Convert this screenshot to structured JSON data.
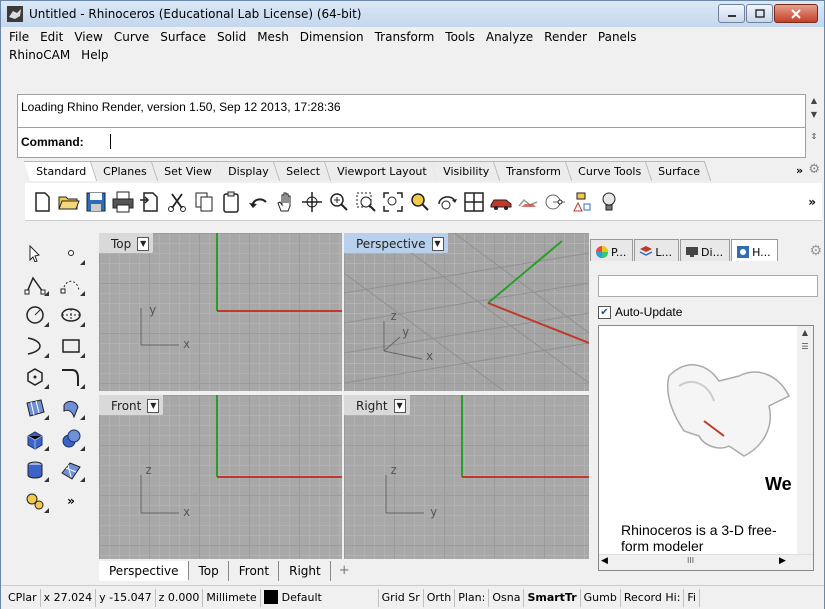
{
  "window": {
    "title": "Untitled - Rhinoceros (Educational Lab License) (64-bit)"
  },
  "menu": {
    "row1": [
      "File",
      "Edit",
      "View",
      "Curve",
      "Surface",
      "Solid",
      "Mesh",
      "Dimension",
      "Transform",
      "Tools",
      "Analyze",
      "Render",
      "Panels"
    ],
    "row2": [
      "RhinoCAM",
      "Help"
    ]
  },
  "command": {
    "history_line": "Loading Rhino Render, version 1.50, Sep 12 2013, 17:28:36",
    "prompt_label": "Command:",
    "value": ""
  },
  "toolbar_tabs": [
    "Standard",
    "CPlanes",
    "Set View",
    "Display",
    "Select",
    "Viewport Layout",
    "Visibility",
    "Transform",
    "Curve Tools",
    "Surface"
  ],
  "toolbar_more": "»",
  "toolbar_icons": [
    "new-file-icon",
    "open-folder-icon",
    "save-icon",
    "print-icon",
    "import-icon",
    "cut-icon",
    "copy-icon",
    "paste-icon",
    "undo-icon",
    "pan-hand-icon",
    "rotate-view-icon",
    "zoom-in-icon",
    "zoom-window-icon",
    "zoom-extents-icon",
    "zoom-selected-icon",
    "rotate-camera-icon",
    "four-viewports-icon",
    "car-render-icon",
    "render-preview-icon",
    "curve-point-icon",
    "named-cplane-icon",
    "light-bulb-icon"
  ],
  "left_toolbar_icons": [
    "select-arrow-icon",
    "point-icon",
    "polyline-icon",
    "control-point-curve-icon",
    "circle-icon",
    "ellipse-icon",
    "arc-icon",
    "rectangle-icon",
    "polygon-icon",
    "fillet-icon",
    "surface-from-points-icon",
    "extrude-surface-icon",
    "box-solid-icon",
    "boolean-icon",
    "cylinder-icon",
    "planar-surface-icon",
    "transform-gear-icon"
  ],
  "left_toolbar_more": "»",
  "viewports": [
    {
      "name": "Top",
      "axis_h": "x",
      "axis_v": "y"
    },
    {
      "name": "Perspective",
      "axis_h": "x",
      "axis_v": "z",
      "axis_d": "y"
    },
    {
      "name": "Front",
      "axis_h": "x",
      "axis_v": "z"
    },
    {
      "name": "Right",
      "axis_h": "y",
      "axis_v": "z"
    }
  ],
  "viewport_tabs": [
    "Perspective",
    "Top",
    "Front",
    "Right"
  ],
  "viewport_tab_add": "+",
  "panel": {
    "tabs": [
      "P...",
      "L...",
      "Di...",
      "H..."
    ],
    "auto_update_label": "Auto-Update",
    "auto_update_checked": true,
    "welcome": "We",
    "body_text": "Rhinoceros is a 3-D free-form modeler",
    "scroll_grip": "III"
  },
  "status": {
    "cplane": "CPlar",
    "x": "x 27.024",
    "y": "y -15.047",
    "z": "z 0.000",
    "units": "Millimete",
    "layer": "Default",
    "grid_snap": "Grid Sr",
    "ortho": "Orth",
    "planar": "Plan:",
    "osnap": "Osna",
    "smarttrack": "SmartTr",
    "gumball": "Gumb",
    "record_history": "Record Hi:",
    "filter": "Fi"
  },
  "colors": {
    "x_axis": "#c0392b",
    "y_axis": "#27a02a",
    "active_viewport": "#b8d0ec"
  }
}
